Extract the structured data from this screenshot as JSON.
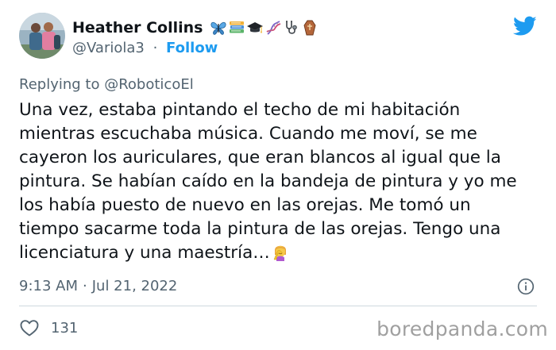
{
  "author": {
    "display_name": "Heather Collins",
    "handle": "@Variola3",
    "follow_label": "Follow",
    "name_emojis": [
      "butterfly",
      "books",
      "graduation-cap",
      "dna",
      "stethoscope",
      "coffin"
    ]
  },
  "reply": {
    "prefix": "Replying to",
    "mention": "@RoboticoEl"
  },
  "tweet": {
    "lines": [
      "Una vez, estaba pintando el techo de mi habitación",
      "mientras escuchaba música. Cuando me moví, se me",
      "cayeron los auriculares, que eran blancos al igual que la",
      "pintura. Se habían caído en la bandeja de pintura y yo me",
      "los había puesto de nuevo en las orejas. Me tomó un",
      "tiempo sacarme toda la pintura de las orejas. Tengo una",
      "licenciatura y una maestría…"
    ],
    "trailing_emoji": "woman-facepalming"
  },
  "meta": {
    "time": "9:13 AM",
    "date": "Jul 21, 2022"
  },
  "engagement": {
    "likes": "131"
  },
  "watermark": {
    "text": "boredpanda.com"
  },
  "colors": {
    "twitter_blue": "#1d9bf0",
    "text_primary": "#0f1419",
    "text_secondary": "#536471",
    "divider": "#cfd9de",
    "watermark": "#a0a0a0"
  }
}
